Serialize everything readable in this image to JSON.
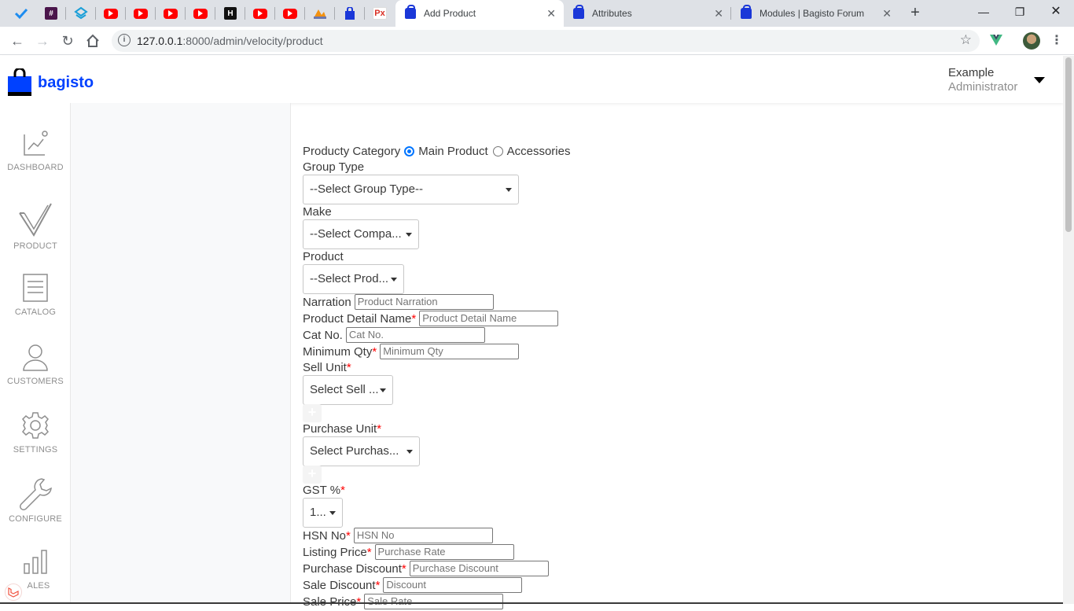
{
  "browser": {
    "pinned_tabs": [
      {
        "icon": "check-app-icon"
      },
      {
        "icon": "slack-icon"
      },
      {
        "icon": "layers-icon"
      },
      {
        "icon": "youtube-icon"
      },
      {
        "icon": "youtube-icon"
      },
      {
        "icon": "youtube-icon"
      },
      {
        "icon": "youtube-icon"
      },
      {
        "icon": "hackerrank-icon"
      },
      {
        "icon": "youtube-icon"
      },
      {
        "icon": "youtube-icon"
      },
      {
        "icon": "phpmyadmin-icon"
      },
      {
        "icon": "bagisto-icon"
      },
      {
        "icon": "px-icon"
      }
    ],
    "tabs": [
      {
        "title": "Add Product",
        "active": true
      },
      {
        "title": "Attributes",
        "active": false
      },
      {
        "title": "Modules | Bagisto Forum",
        "active": false
      }
    ],
    "url_host": "127.0.0.1",
    "url_rest": ":8000/admin/velocity/product",
    "px_label": "Px",
    "hr_label": "H"
  },
  "header": {
    "brand": "bagisto",
    "user_name": "Example",
    "user_role": "Administrator"
  },
  "sidebar": {
    "items": [
      {
        "label": "DASHBOARD",
        "icon": "dashboard-icon"
      },
      {
        "label": "PRODUCT",
        "icon": "product-check-icon"
      },
      {
        "label": "CATALOG",
        "icon": "catalog-list-icon"
      },
      {
        "label": "CUSTOMERS",
        "icon": "customer-user-icon"
      },
      {
        "label": "SETTINGS",
        "icon": "settings-gear-icon"
      },
      {
        "label": "CONFIGURE",
        "icon": "configure-wrench-icon"
      },
      {
        "label": "ALES",
        "icon": "sales-bars-icon"
      }
    ]
  },
  "form": {
    "category_label": "Producty Category",
    "category_options": [
      "Main Product",
      "Accessories"
    ],
    "category_selected": "Main Product",
    "group_type_label": "Group Type",
    "group_type_value": "--Select Group Type--",
    "make_label": "Make",
    "make_value": "--Select Compa...",
    "product_label": "Product",
    "product_value": "--Select Prod...",
    "narration_label": "Narration",
    "narration_placeholder": "Product Narration",
    "detail_name_label": "Product Detail Name",
    "detail_name_placeholder": "Product Detail Name",
    "catno_label": "Cat No.",
    "catno_placeholder": "Cat No.",
    "minqty_label": "Minimum Qty",
    "minqty_placeholder": "Minimum Qty",
    "sell_unit_label": "Sell Unit",
    "sell_unit_value": "Select Sell ...",
    "purchase_unit_label": "Purchase Unit",
    "purchase_unit_value": "Select Purchas...",
    "gst_label": "GST %",
    "gst_value": "1...",
    "hsn_label": "HSN No",
    "hsn_placeholder": "HSN No",
    "listing_label": "Listing Price",
    "listing_placeholder": "Purchase Rate",
    "pdiscount_label": "Purchase Discount",
    "pdiscount_placeholder": "Purchase Discount",
    "sdiscount_label": "Sale Discount",
    "sdiscount_placeholder": "Discount",
    "saleprice_label": "Sale Price",
    "saleprice_placeholder": "Sale Rate",
    "required_mark": "*",
    "add_symbol": "+"
  }
}
